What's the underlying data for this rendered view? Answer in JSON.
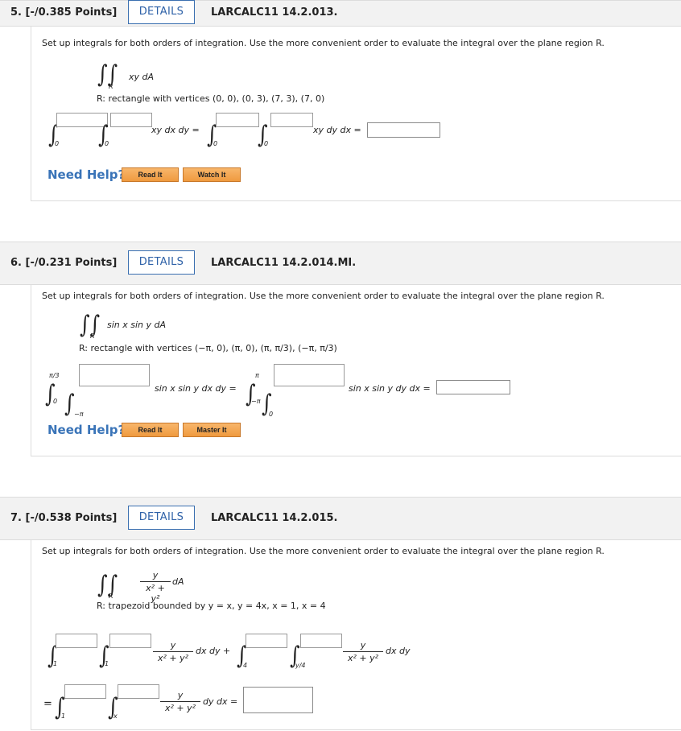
{
  "q5": {
    "points": "5. [-/0.385 Points]",
    "details": "DETAILS",
    "code": "LARCALC11 14.2.013.",
    "instruction": "Set up integrals for both orders of integration. Use the more convenient order to evaluate the integral over the plane region R.",
    "integrand": "xy dA",
    "region_sub": "R",
    "region": "R: rectangle with vertices (0, 0), (0, 3), (7, 3), (7, 0)",
    "lower": "0",
    "expr1": "xy dx dy =",
    "expr2": "xy dy dx =",
    "need_help": "Need Help?",
    "btn1": "Read It",
    "btn2": "Watch It"
  },
  "q6": {
    "points": "6. [-/0.231 Points]",
    "details": "DETAILS",
    "code": "LARCALC11 14.2.014.MI.",
    "instruction": "Set up integrals for both orders of integration. Use the more convenient order to evaluate the integral over the plane region R.",
    "integrand": "sin x sin y dA",
    "region_sub": "R",
    "region": "R: rectangle with vertices (−π, 0), (π, 0), (π, π/3), (−π, π/3)",
    "upper_outer1": "π/3",
    "lower_outer1": "0",
    "lower_inner1": "−π",
    "upper_outer2": "π",
    "lower_outer2": "−π",
    "lower_inner2": "0",
    "expr1": "sin x sin y dx dy =",
    "expr2": "sin x sin y dy dx =",
    "need_help": "Need Help?",
    "btn1": "Read It",
    "btn2": "Master It"
  },
  "q7": {
    "points": "7. [-/0.538 Points]",
    "details": "DETAILS",
    "code": "LARCALC11 14.2.015.",
    "instruction": "Set up integrals for both orders of integration. Use the more convenient order to evaluate the integral over the plane region R.",
    "numerator": "y",
    "denominator": "x² + y²",
    "dA": "dA",
    "region_sub": "R",
    "region": "R: trapezoid bounded by y = x, y = 4x, x = 1, x = 4",
    "lim_a": "1",
    "lim_b": "1",
    "lim_c": "4",
    "lim_d": "y/4",
    "lim_e": "1",
    "lim_f": "x",
    "d1": "dx dy +",
    "d2": "dx dy",
    "eq": "=",
    "d3": "dy dx ="
  }
}
